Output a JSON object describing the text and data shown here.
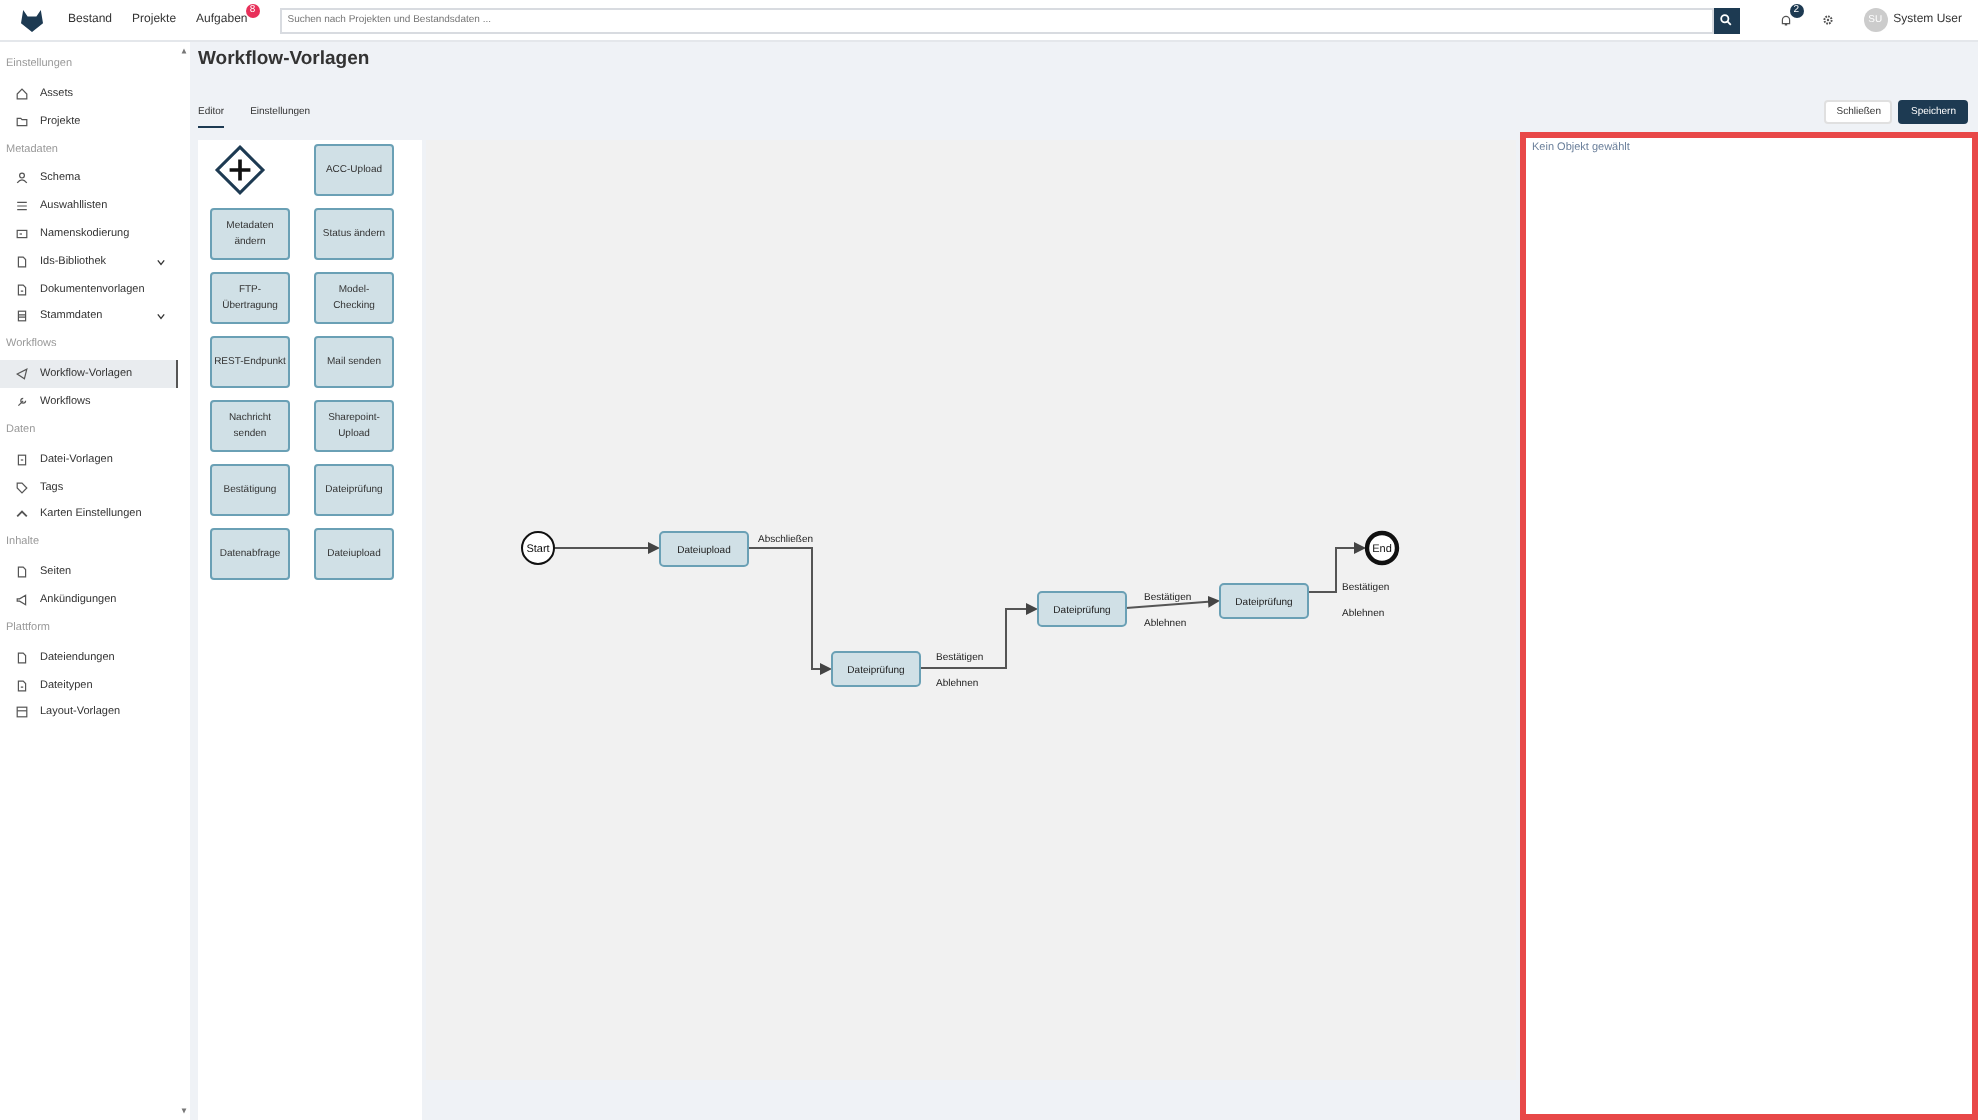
{
  "topbar": {
    "nav": [
      {
        "label": "Bestand"
      },
      {
        "label": "Projekte"
      },
      {
        "label": "Aufgaben",
        "badge": "8"
      }
    ],
    "search": {
      "placeholder": "Suchen nach Projekten und Bestandsdaten ..."
    },
    "notifications_badge": "2",
    "user": {
      "initials": "SU",
      "name": "System User"
    }
  },
  "sidebar": {
    "sections": [
      {
        "title": "Einstellungen",
        "items": [
          {
            "label": "Assets",
            "selected": false
          },
          {
            "label": "Projekte",
            "selected": false
          }
        ]
      },
      {
        "title": "Metadaten",
        "items": [
          {
            "label": "Schema",
            "selected": false
          },
          {
            "label": "Auswahllisten",
            "selected": false
          },
          {
            "label": "Namenskodierung",
            "selected": false
          },
          {
            "label": "Ids-Bibliothek",
            "selected": false,
            "expanded": false
          },
          {
            "label": "Dokumentenvorlagen",
            "selected": false
          },
          {
            "label": "Stammdaten",
            "selected": false,
            "expanded": false
          }
        ]
      },
      {
        "title": "Workflows",
        "items": [
          {
            "label": "Workflow-Vorlagen",
            "selected": true
          },
          {
            "label": "Workflows",
            "selected": false
          }
        ]
      },
      {
        "title": "Daten",
        "items": [
          {
            "label": "Datei-Vorlagen",
            "selected": false
          },
          {
            "label": "Tags",
            "selected": false
          },
          {
            "label": "Karten Einstellungen",
            "selected": false
          }
        ]
      },
      {
        "title": "Inhalte",
        "items": [
          {
            "label": "Seiten",
            "selected": false
          },
          {
            "label": "Ankündigungen",
            "selected": false
          }
        ]
      },
      {
        "title": "Plattform",
        "items": [
          {
            "label": "Dateiendungen",
            "selected": false
          },
          {
            "label": "Dateitypen",
            "selected": false
          },
          {
            "label": "Layout-Vorlagen",
            "selected": false
          }
        ]
      }
    ]
  },
  "page": {
    "title": "Workflow-Vorlagen",
    "tabs": [
      {
        "label": "Editor",
        "selected": true
      },
      {
        "label": "Einstellungen",
        "selected": false
      }
    ],
    "buttons": [
      {
        "label": "Schließen",
        "kind": "secondary"
      },
      {
        "label": "Speichern",
        "kind": "primary"
      }
    ]
  },
  "palette": [
    {
      "kind": "gateway"
    },
    {
      "kind": "task",
      "label": "ACC-Upload"
    },
    {
      "kind": "task",
      "label": "Metadaten ändern"
    },
    {
      "kind": "task",
      "label": "Status ändern"
    },
    {
      "kind": "task",
      "label": "FTP-Übertragung"
    },
    {
      "kind": "task",
      "label": "Model-Checking"
    },
    {
      "kind": "task",
      "label": "REST-Endpunkt"
    },
    {
      "kind": "task",
      "label": "Mail senden"
    },
    {
      "kind": "task",
      "label": "Nachricht senden"
    },
    {
      "kind": "task",
      "label": "Sharepoint-Upload"
    },
    {
      "kind": "task",
      "label": "Bestätigung"
    },
    {
      "kind": "task",
      "label": "Dateiprüfung"
    },
    {
      "kind": "task",
      "label": "Datenabfrage"
    },
    {
      "kind": "task",
      "label": "Dateiupload"
    }
  ],
  "diagram": {
    "nodes": [
      {
        "kind": "start",
        "label": "Start"
      },
      {
        "kind": "task",
        "label": "Dateiupload"
      },
      {
        "kind": "task",
        "label": "Dateiprüfung"
      },
      {
        "kind": "task",
        "label": "Dateiprüfung"
      },
      {
        "kind": "task",
        "label": "Dateiprüfung"
      },
      {
        "kind": "end",
        "label": "End"
      }
    ],
    "edges": [
      {
        "kind": "arrow"
      },
      {
        "kind": "arrow",
        "labels": [
          "Abschließen"
        ]
      },
      {
        "kind": "arrow",
        "labels": [
          "Bestätigen",
          "Ablehnen"
        ]
      },
      {
        "kind": "arrow",
        "labels": [
          "Bestätigen",
          "Ablehnen"
        ]
      },
      {
        "kind": "arrow",
        "labels": [
          "Bestätigen",
          "Ablehnen"
        ]
      }
    ]
  },
  "properties": {
    "empty_text": "Kein Objekt gewählt"
  }
}
